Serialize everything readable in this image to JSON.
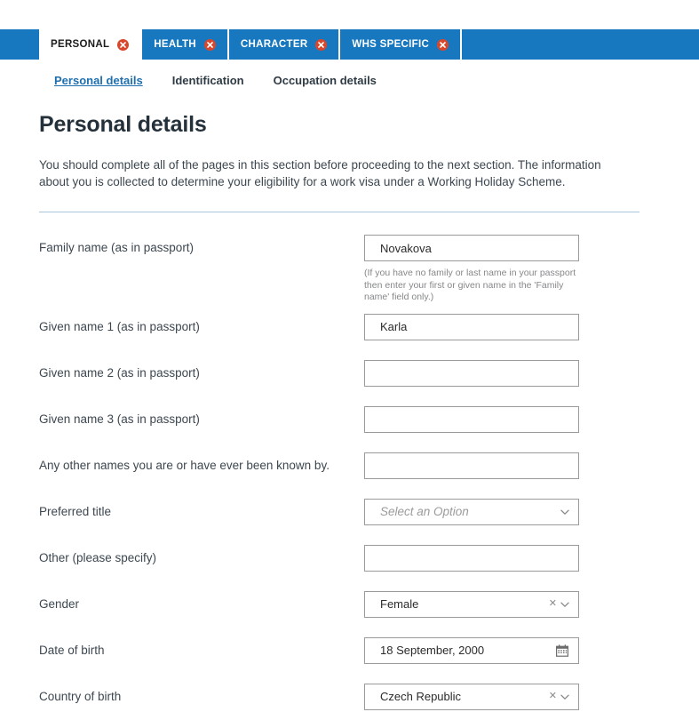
{
  "tabs": [
    {
      "label": "PERSONAL",
      "active": true,
      "close_icon": "close-circle-icon"
    },
    {
      "label": "HEALTH",
      "active": false,
      "close_icon": "close-circle-icon"
    },
    {
      "label": "CHARACTER",
      "active": false,
      "close_icon": "close-circle-icon"
    },
    {
      "label": "WHS SPECIFIC",
      "active": false,
      "close_icon": "close-circle-icon"
    }
  ],
  "sub_nav": [
    {
      "label": "Personal details",
      "current": true
    },
    {
      "label": "Identification",
      "current": false
    },
    {
      "label": "Occupation details",
      "current": false
    }
  ],
  "page": {
    "title": "Personal details",
    "intro": "You should complete all of the pages in this section before proceeding to the next section. The information about you is collected to determine your eligibility for a work visa under a Working Holiday Scheme."
  },
  "fields": {
    "family_name": {
      "label": "Family name (as in passport)",
      "value": "Novakova",
      "help": "(If you have no family or last name in your passport then enter your first or given name in the 'Family name' field only.)"
    },
    "given_name_1": {
      "label": "Given name 1 (as in passport)",
      "value": "Karla"
    },
    "given_name_2": {
      "label": "Given name 2 (as in passport)",
      "value": ""
    },
    "given_name_3": {
      "label": "Given name 3 (as in passport)",
      "value": ""
    },
    "other_names": {
      "label": "Any other names you are or have ever been known by.",
      "value": ""
    },
    "preferred_title": {
      "label": "Preferred title",
      "value": "",
      "placeholder": "Select an Option",
      "chevron_icon": "chevron-down-icon"
    },
    "other_specify": {
      "label": "Other (please specify)",
      "value": ""
    },
    "gender": {
      "label": "Gender",
      "value": "Female",
      "clear_icon": "clear-x-icon",
      "chevron_icon": "chevron-down-icon"
    },
    "date_of_birth": {
      "label": "Date of birth",
      "value": "18 September, 2000",
      "calendar_icon": "calendar-icon"
    },
    "country_of_birth": {
      "label": "Country of birth",
      "value": "Czech Republic",
      "clear_icon": "clear-x-icon",
      "chevron_icon": "chevron-down-icon"
    }
  },
  "colors": {
    "brand_blue": "#1878bf",
    "close_red": "#d8472b",
    "link_blue": "#1f6fae",
    "divider": "#a9c6dd"
  }
}
